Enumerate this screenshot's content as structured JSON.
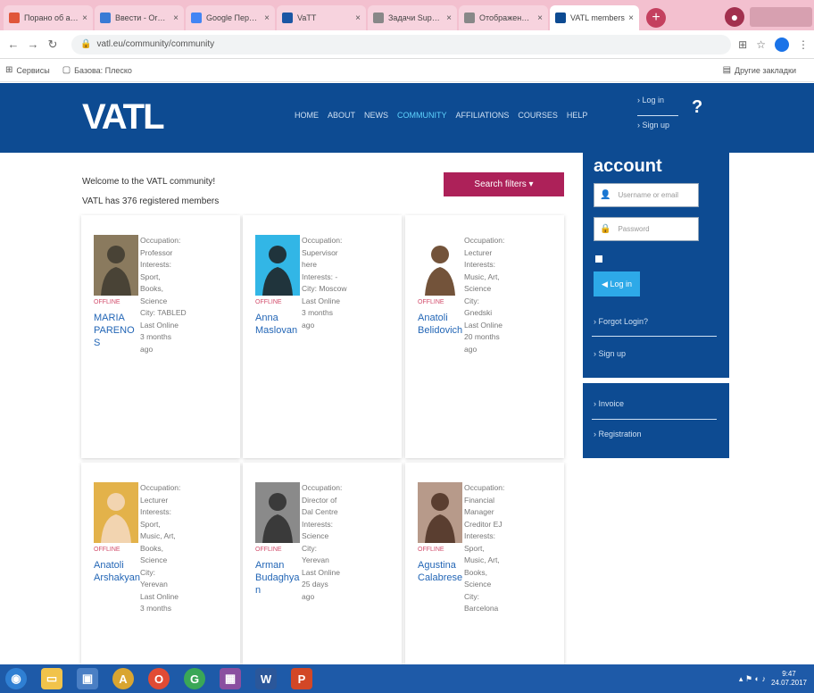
{
  "browser": {
    "tabs": [
      {
        "title": "Порано об акции",
        "color": "#e0563a",
        "active": false
      },
      {
        "title": "Ввести - Orderyou",
        "color": "#3a7bd5",
        "active": false
      },
      {
        "title": "Google Переводчик",
        "color": "#4285f4",
        "active": false
      },
      {
        "title": "VaTT",
        "color": "#1b56a4",
        "active": false
      },
      {
        "title": "Задачи Support vs",
        "color": "#888888",
        "active": false
      },
      {
        "title": "Отображение и с",
        "color": "#888888",
        "active": false
      },
      {
        "title": "VATL members",
        "color": "#0d4b92",
        "active": true
      }
    ],
    "url": "vatl.eu/community/community",
    "bookmarks": [
      {
        "icon": "apps-icon",
        "label": "Сервисы"
      },
      {
        "icon": "page-icon",
        "label": "Базова: Плеско"
      }
    ],
    "bookmarks_right": "Другие закладки"
  },
  "site": {
    "logo": "VATL",
    "nav": [
      {
        "label": "HOME",
        "current": false
      },
      {
        "label": "ABOUT",
        "current": false
      },
      {
        "label": "NEWS",
        "current": false
      },
      {
        "label": "COMMUNITY",
        "current": true
      },
      {
        "label": "AFFILIATIONS",
        "current": false
      },
      {
        "label": "COURSES",
        "current": false
      },
      {
        "label": "HELP",
        "current": false
      }
    ],
    "login_link": "Log in",
    "signup_link": "Sign up",
    "help_symbol": "?"
  },
  "main": {
    "welcome": "Welcome to the VATL community!",
    "member_count": "VATL has 376 registered members",
    "search_button": "Search filters ▾",
    "members": [
      {
        "status": "OFFLINE",
        "name": "MARIA PARENOS",
        "info": [
          "Occupation:",
          "Professor",
          "Interests:",
          "Sport,",
          "Books,",
          "Science",
          "City: TABLED",
          "Last Online",
          "3 months",
          "ago"
        ],
        "photo_bg": "#8a7a5e",
        "photo_fg": "#3d3a2f"
      },
      {
        "status": "OFFLINE",
        "name": "Anna Maslovan",
        "info": [
          "Occupation:",
          "Supervisor",
          "here",
          "Interests: -",
          "City: Moscow",
          "Last Online",
          "3 months",
          "ago"
        ],
        "photo_bg": "#32b6e6",
        "photo_fg": "#1d1d1d"
      },
      {
        "status": "OFFLINE",
        "name": "Anatoli Belidovich",
        "info": [
          "Occupation:",
          "Lecturer",
          "Interests:",
          "Music, Art,",
          "Science",
          "City:",
          "Gnedski",
          "Last Online",
          "20 months",
          "ago"
        ],
        "photo_bg": "#ffffff",
        "photo_fg": "#5a3518"
      },
      {
        "status": "OFFLINE",
        "name": "Anatoli Arshakyan",
        "info": [
          "Occupation:",
          "Lecturer",
          "Interests:",
          "Sport,",
          "Music, Art,",
          "Books,",
          "Science",
          "City:",
          "Yerevan",
          "Last Online",
          "3 months"
        ],
        "photo_bg": "#e3b24a",
        "photo_fg": "#f5d9c2"
      },
      {
        "status": "OFFLINE",
        "name": "Arman Budaghyan",
        "info": [
          "Occupation:",
          "Director of",
          "Dal Centre",
          "Interests:",
          "Science",
          "City:",
          "Yerevan",
          "Last Online",
          "25 days",
          "ago"
        ],
        "photo_bg": "#8a8a8a",
        "photo_fg": "#2b2b2b"
      },
      {
        "status": "OFFLINE",
        "name": "Agustina Calabrese",
        "info": [
          "Occupation:",
          "Financial",
          "Manager",
          "Creditor EJ",
          "Interests:",
          "Sport,",
          "Music, Art,",
          "Books,",
          "Science",
          "City:",
          "Barcelona"
        ],
        "photo_bg": "#b79a8a",
        "photo_fg": "#4a2e20"
      }
    ]
  },
  "sidebar": {
    "title": "account",
    "username_placeholder": "Username or email",
    "password_placeholder": "Password",
    "login_button": "◀ Log in",
    "forgot_link": "Forgot Login?",
    "signup_link": "Sign up",
    "links2": [
      "Invoice",
      "Registration"
    ]
  },
  "taskbar": {
    "time": "9:47",
    "date": "24.07.2017"
  }
}
